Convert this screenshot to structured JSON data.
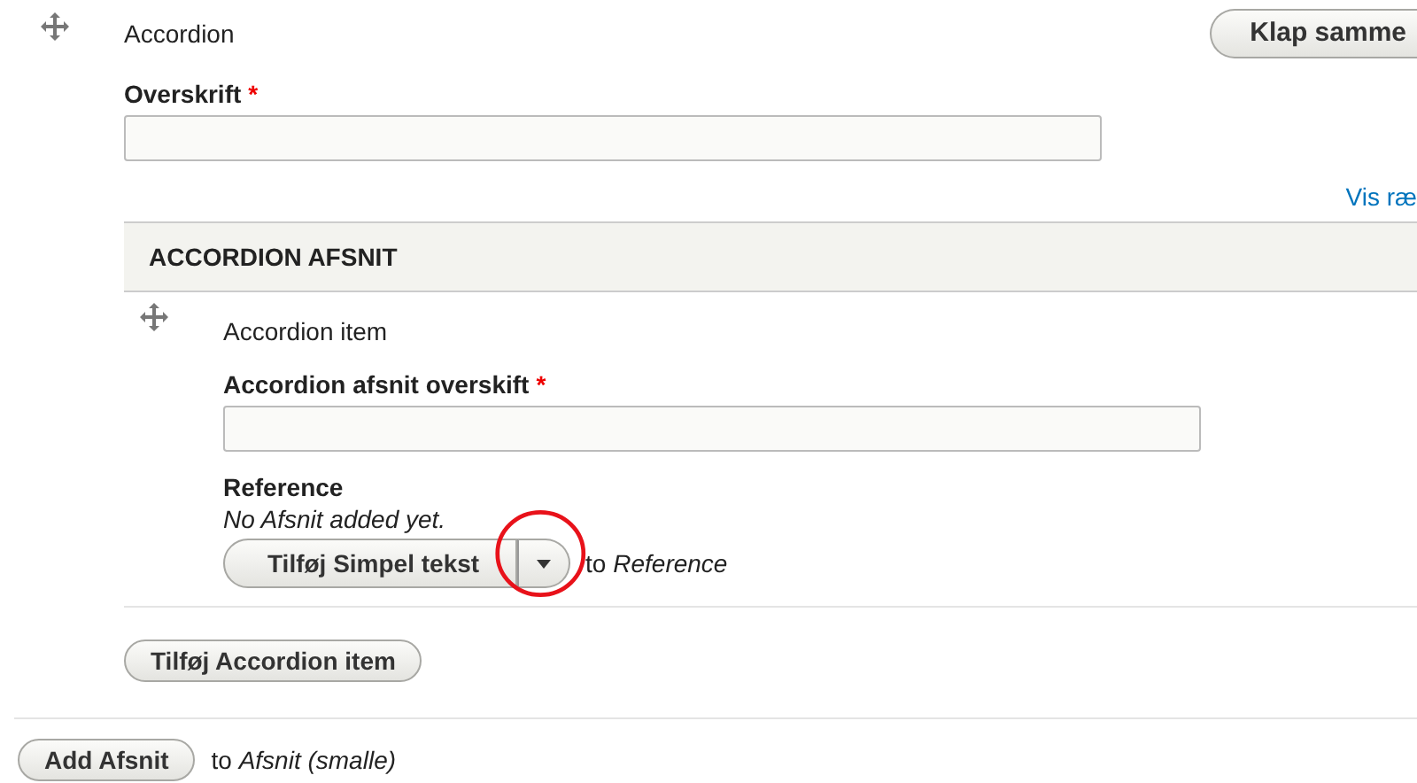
{
  "paragraph": {
    "title": "Accordion",
    "collapse_button": "Klap samme",
    "heading_field": {
      "label": "Overskrift",
      "required_mark": "*"
    },
    "show_link": "Vis ræ",
    "section": {
      "title": "ACCORDION AFSNIT",
      "items": [
        {
          "title": "Accordion item",
          "field": {
            "label": "Accordion afsnit overskift",
            "required_mark": "*"
          },
          "reference": {
            "label": "Reference",
            "empty_text": "No Afsnit added yet.",
            "add_button": "Tilføj Simpel tekst",
            "to_text": "to *Reference*"
          }
        }
      ],
      "add_button": "Tilføj Accordion item"
    }
  },
  "add_button": "Add Afsnit",
  "to_text": "to *Afsnit (smalle)*"
}
